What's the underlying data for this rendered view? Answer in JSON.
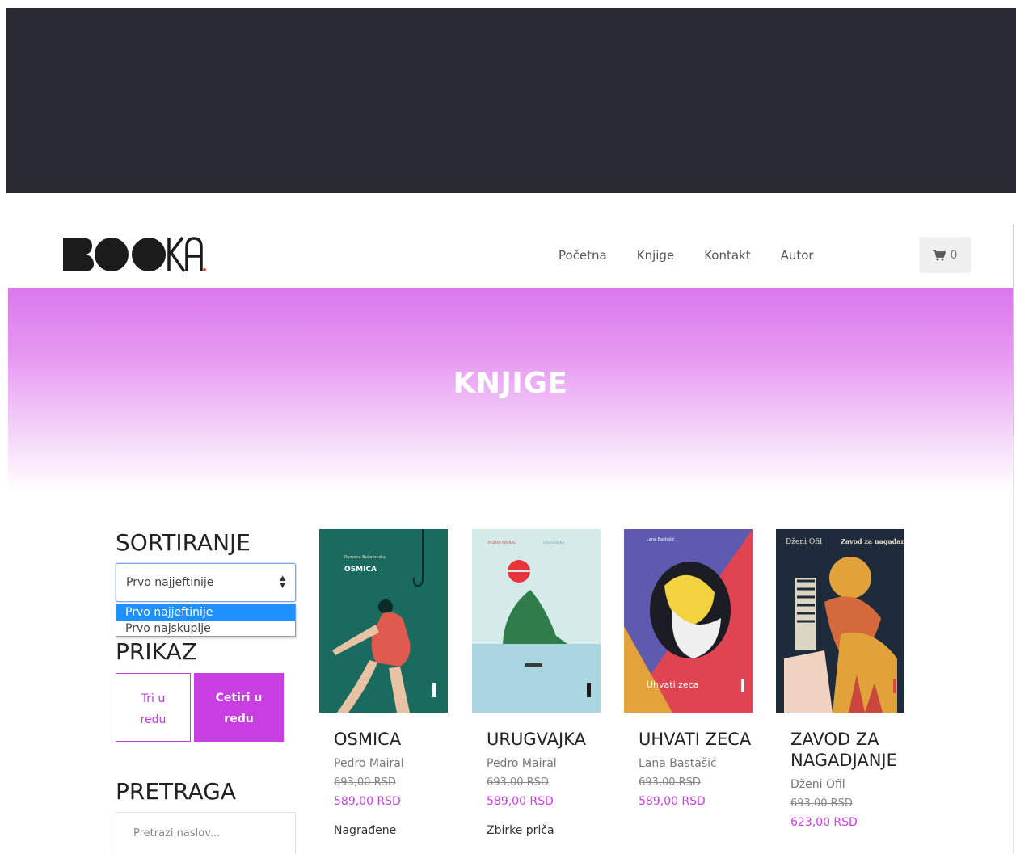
{
  "colors": {
    "top_bar": "#282a31",
    "accent": "#c93ee3",
    "hero_gradient_top": "#da78ec",
    "price_color": "#c93ee3"
  },
  "brand": {
    "logo_text": "BOOKA",
    "logo_dot_color": "#e64b4b"
  },
  "nav": {
    "links": [
      "Početna",
      "Knjige",
      "Kontakt",
      "Autor"
    ],
    "cart_icon": "cart-icon",
    "cart_count": "0"
  },
  "hero": {
    "title": "KNJIGE"
  },
  "sidebar": {
    "sort_heading": "SORTIRANJE",
    "sort_selected": "Prvo najjeftinije",
    "sort_options": [
      "Prvo najjeftinije",
      "Prvo najskuplje"
    ],
    "view_heading": "PRIKAZ",
    "view_three_line1": "Tri u",
    "view_three_line2": "redu",
    "view_four_line1": "Cetiri u",
    "view_four_line2": "redu",
    "search_heading": "PRETRAGA",
    "search_placeholder": "Pretrazi naslov..."
  },
  "books": [
    {
      "title": "OSMICA",
      "author": "Pedro Mairal",
      "old_price": "693,00 RSD",
      "new_price": "589,00 RSD",
      "category": "Nagrađene",
      "cover_author": "Rumena Bužarovska",
      "cover_title": "OSMICA"
    },
    {
      "title": "URUGVAJKA",
      "author": "Pedro Mairal",
      "old_price": "693,00 RSD",
      "new_price": "589,00 RSD",
      "category": "Zbirke priča",
      "cover_author": "PEDRO MAIRAL",
      "cover_title": "URUGVAJKA"
    },
    {
      "title": "UHVATI ZECA",
      "author": "Lana Bastašić",
      "old_price": "693,00 RSD",
      "new_price": "589,00 RSD",
      "category": "",
      "cover_author": "Lana Bastašić",
      "cover_title": "Uhvati zeca"
    },
    {
      "title": "ZAVOD ZA NAGADJANJE",
      "author": "Dženi Ofil",
      "old_price": "693,00 RSD",
      "new_price": "623,00 RSD",
      "category": "",
      "cover_author": "Dženi Ofil",
      "cover_title": "Zavod za nagađanje"
    }
  ]
}
